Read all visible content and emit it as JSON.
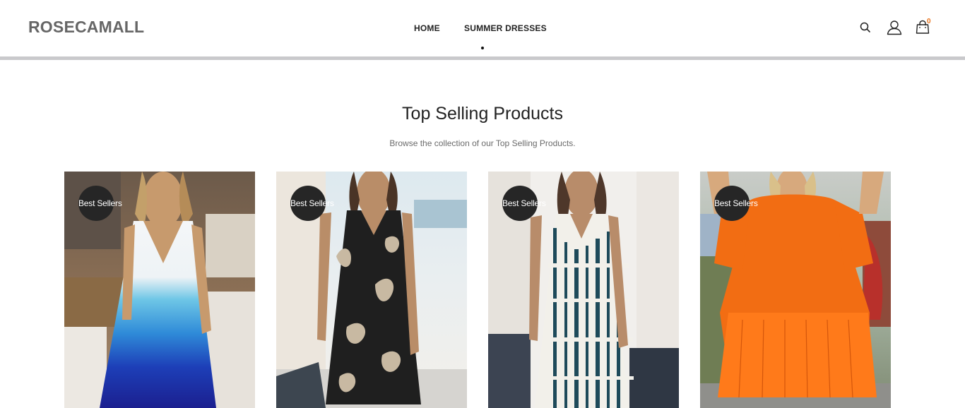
{
  "header": {
    "logo": "ROSECAMALL",
    "nav": [
      {
        "label": "HOME"
      },
      {
        "label": "SUMMER DRESSES"
      }
    ],
    "icons": [
      "search-icon",
      "user-icon",
      "shopping-bag-icon"
    ],
    "cart_count": "0"
  },
  "section": {
    "title": "Top Selling Products",
    "subtitle": "Browse the collection of our Top Selling Products."
  },
  "products": [
    {
      "badge": "Best Sellers",
      "image": "white-to-blue gradient sleeveless dress"
    },
    {
      "badge": "Best Sellers",
      "image": "black leaf print sleeveless dress"
    },
    {
      "badge": "Best Sellers",
      "image": "white and teal tie-dye sleeveless dress"
    },
    {
      "badge": "Best Sellers",
      "image": "orange ruffle hem dress"
    }
  ],
  "colors": {
    "logo": "#666666",
    "badge": "#262626",
    "cart_count": "#e8731c",
    "header_bar": "#c9c9cc"
  }
}
